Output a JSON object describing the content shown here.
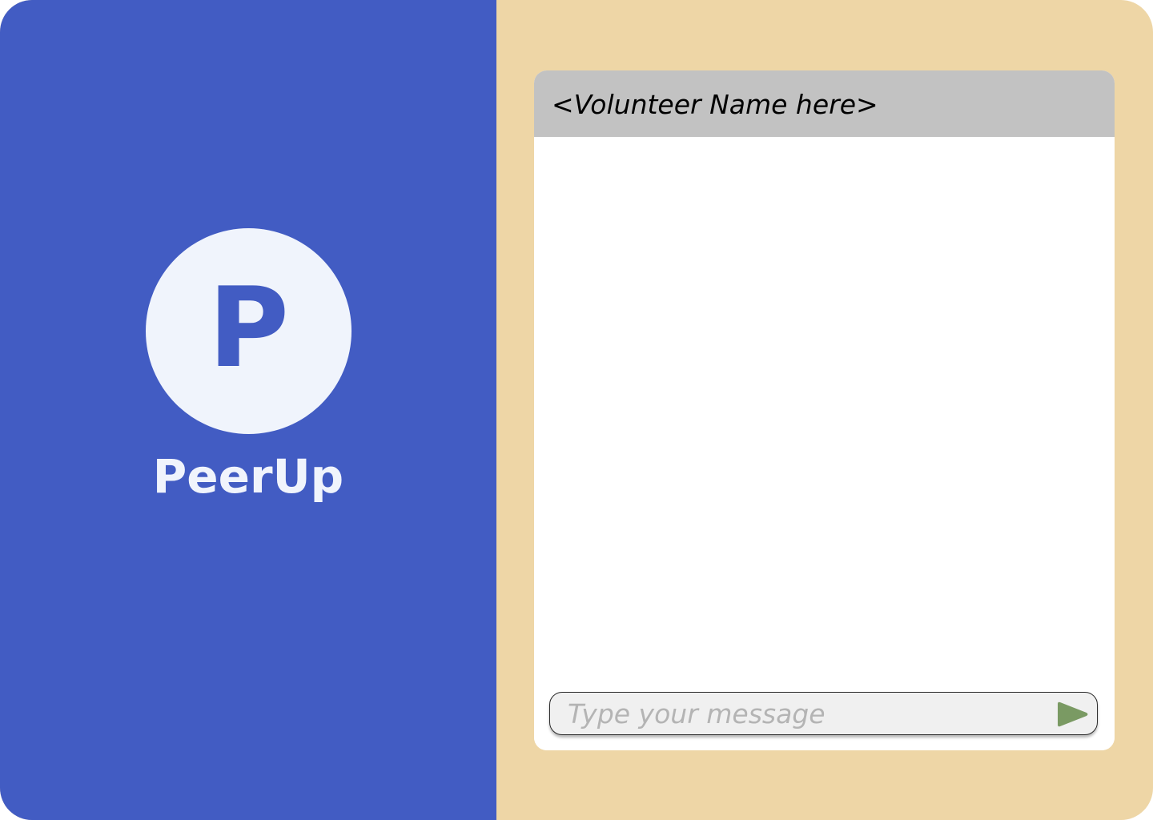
{
  "brand": {
    "logo_letter": "P",
    "name": "PeerUp"
  },
  "chat": {
    "volunteer_name": "<Volunteer Name here>",
    "composer": {
      "placeholder": "Type your message",
      "value": ""
    },
    "send_icon": "send-arrow-icon"
  },
  "colors": {
    "brand_blue": "#425CC3",
    "brand_light": "#F0F4FC",
    "background_sand": "#EED6A6",
    "header_gray": "#C2C2C2",
    "send_green": "#7A9A63"
  }
}
